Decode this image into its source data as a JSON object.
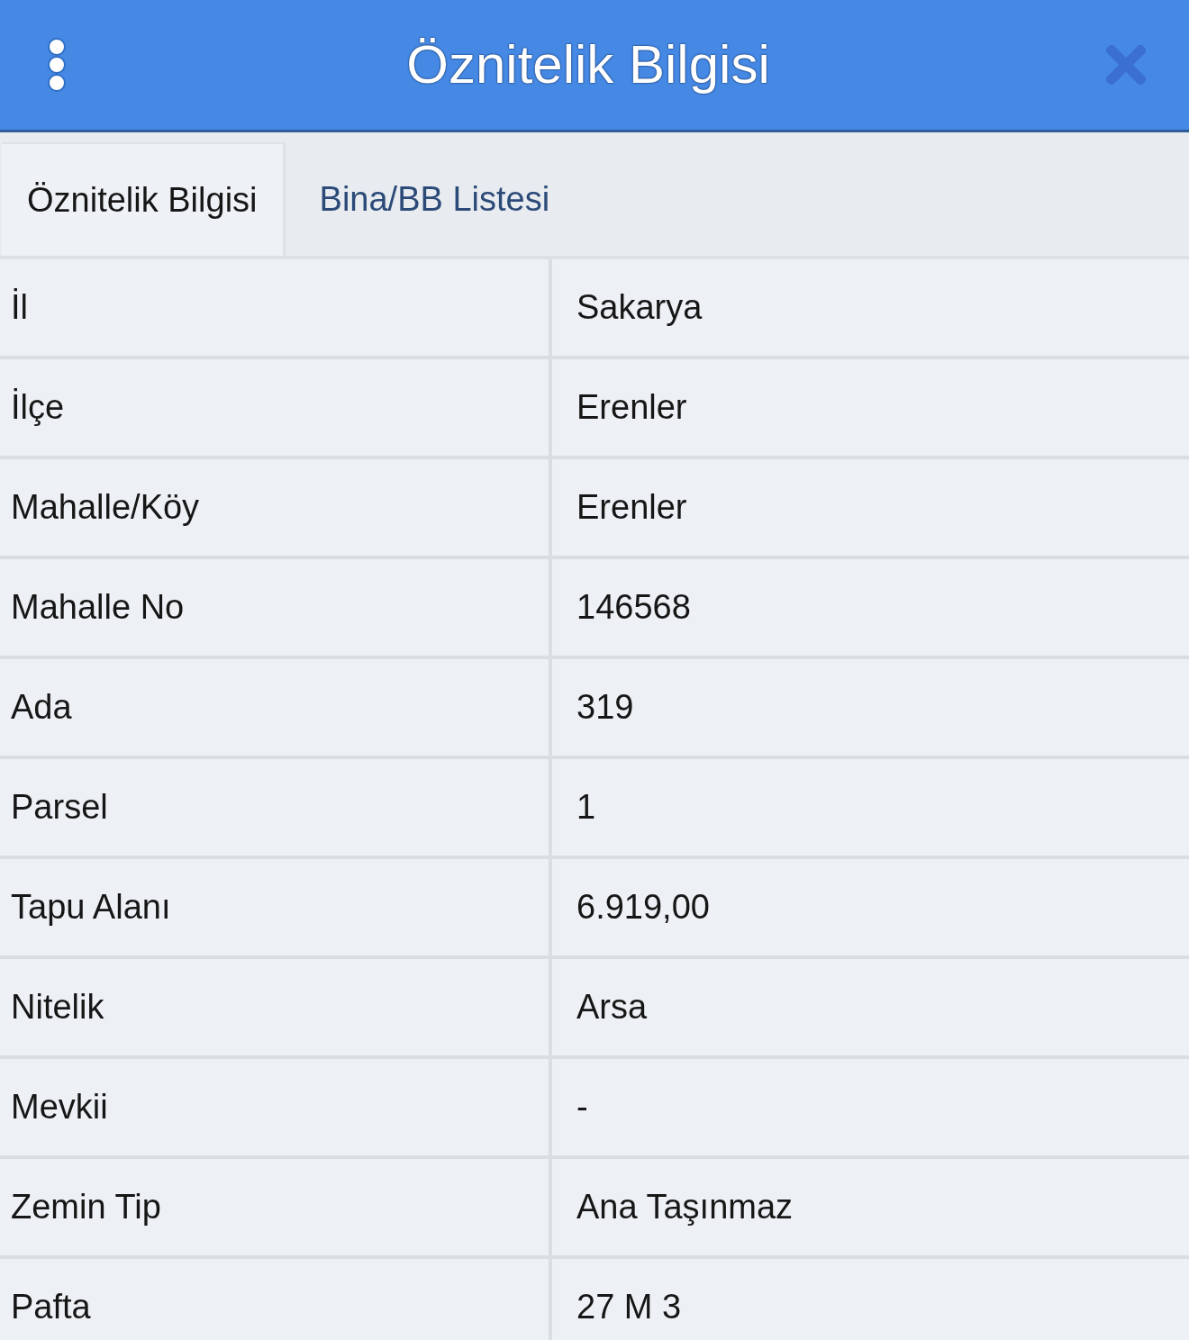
{
  "header": {
    "title": "Öznitelik Bilgisi"
  },
  "tabs": [
    {
      "label": "Öznitelik Bilgisi",
      "selected": true
    },
    {
      "label": "Bina/BB Listesi",
      "selected": false
    }
  ],
  "table": {
    "rows": [
      {
        "label": "İl",
        "value": "Sakarya"
      },
      {
        "label": "İlçe",
        "value": "Erenler"
      },
      {
        "label": "Mahalle/Köy",
        "value": "Erenler"
      },
      {
        "label": "Mahalle No",
        "value": "146568"
      },
      {
        "label": "Ada",
        "value": "319"
      },
      {
        "label": "Parsel",
        "value": "1"
      },
      {
        "label": "Tapu Alanı",
        "value": "6.919,00"
      },
      {
        "label": "Nitelik",
        "value": "Arsa"
      },
      {
        "label": "Mevkii",
        "value": "-"
      },
      {
        "label": "Zemin Tip",
        "value": "Ana Taşınmaz"
      },
      {
        "label": "Pafta",
        "value": "27 M 3"
      }
    ]
  }
}
